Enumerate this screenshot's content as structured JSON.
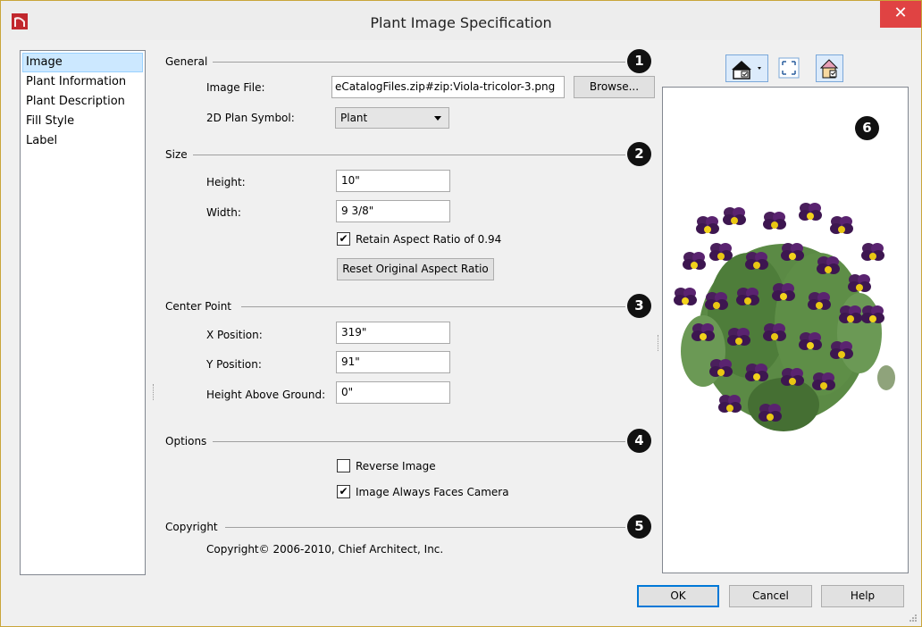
{
  "window": {
    "title": "Plant Image Specification",
    "close_label": "✕",
    "app_icon": "chief-architect-logo-icon"
  },
  "nav": {
    "items": [
      {
        "label": "Image",
        "selected": true
      },
      {
        "label": "Plant Information",
        "selected": false
      },
      {
        "label": "Plant Description",
        "selected": false
      },
      {
        "label": "Fill Style",
        "selected": false
      },
      {
        "label": "Label",
        "selected": false
      }
    ]
  },
  "general": {
    "label": "General",
    "badge": "1",
    "image_file_label": "Image File:",
    "image_file_value": "eCatalogFiles.zip#zip:Viola-tricolor-3.png",
    "browse_label": "Browse...",
    "plan_symbol_label": "2D Plan Symbol:",
    "plan_symbol_value": "Plant"
  },
  "size": {
    "label": "Size",
    "badge": "2",
    "height_label": "Height:",
    "height_value": "10\"",
    "width_label": "Width:",
    "width_value": "9 3/8\"",
    "retain_label": "Retain Aspect Ratio of 0.94",
    "retain_checked": true,
    "reset_label": "Reset Original Aspect Ratio"
  },
  "center": {
    "label": "Center Point",
    "badge": "3",
    "x_label": "X Position:",
    "x_value": "319\"",
    "y_label": "Y Position:",
    "y_value": "91\"",
    "z_label": "Height Above Ground:",
    "z_value": "0\""
  },
  "options": {
    "label": "Options",
    "badge": "4",
    "reverse_label": "Reverse Image",
    "reverse_checked": false,
    "faces_label": "Image Always Faces Camera",
    "faces_checked": true
  },
  "copyright": {
    "label": "Copyright",
    "badge": "5",
    "text": "Copyright© 2006-2010, Chief Architect, Inc."
  },
  "preview": {
    "badge": "6",
    "image": "viola-tricolor-plant-image"
  },
  "footer": {
    "ok_label": "OK",
    "cancel_label": "Cancel",
    "help_label": "Help"
  },
  "check_mark": "✔"
}
